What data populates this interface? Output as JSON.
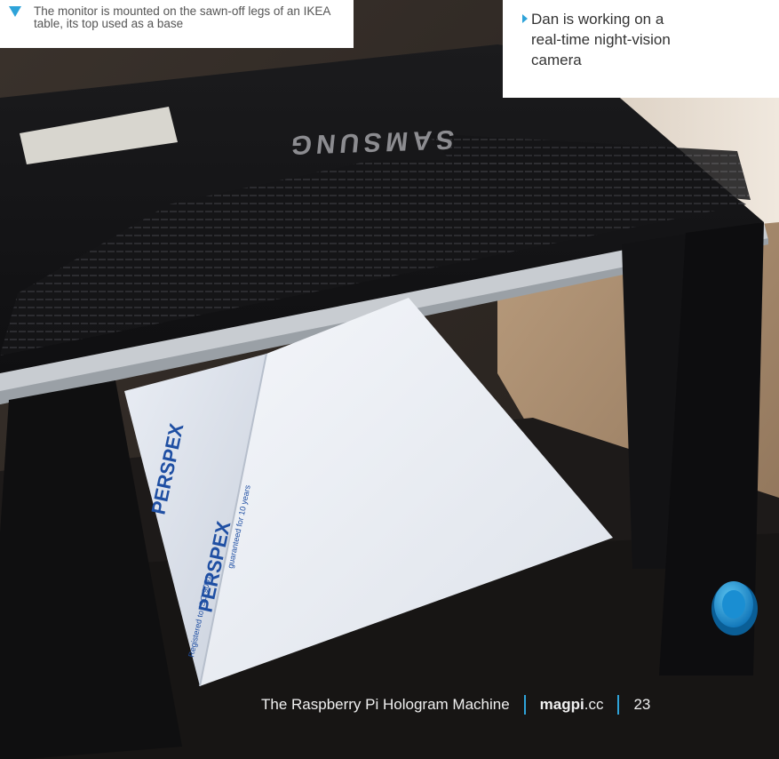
{
  "photo": {
    "monitor_brand": "SAMSUNG",
    "panel_label": "PERSPEX",
    "panel_small_1": "Registered to ISO 9001",
    "panel_small_2": "guaranteed for 10 years"
  },
  "caption": {
    "text": "The monitor is mounted on the sawn-off legs of an IKEA table, its top used as a base",
    "arrow_color": "#2ea3d9"
  },
  "side_caption": {
    "text": "Dan is working on a real-time night-vision camera"
  },
  "footer": {
    "title": "The Raspberry Pi Hologram Machine",
    "brand_bold": "magpi",
    "brand_rest": ".cc",
    "page_number": "23"
  }
}
